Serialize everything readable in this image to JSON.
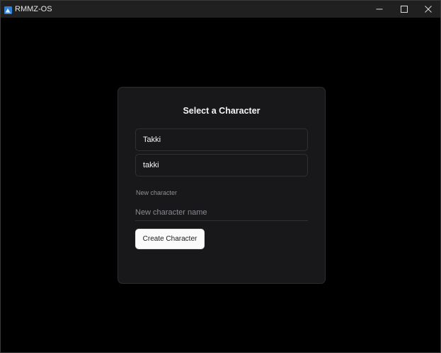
{
  "window": {
    "title": "RMMZ-OS",
    "icon": "app-icon"
  },
  "card": {
    "title": "Select a Character",
    "characters": [
      {
        "name": "Takki"
      },
      {
        "name": "takki"
      }
    ],
    "new_character": {
      "label": "New character",
      "placeholder": "New character name",
      "value": ""
    },
    "create_button_label": "Create Character"
  },
  "colors": {
    "background": "#000000",
    "card": "#18181b",
    "border": "#2f2f34",
    "text": "#f4f4f5",
    "muted": "#8f8f96",
    "button": "#fafafa"
  }
}
